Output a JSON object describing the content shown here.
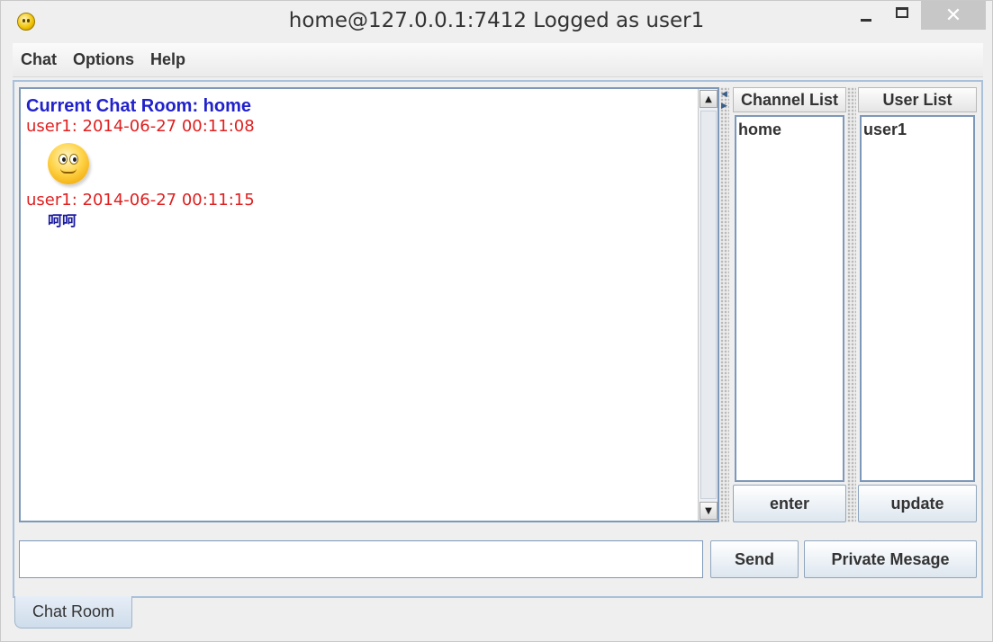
{
  "window": {
    "title": "home@127.0.0.1:7412 Logged as user1",
    "close_glyph": "✕"
  },
  "menu": [
    "Chat",
    "Options",
    "Help"
  ],
  "chat": {
    "room_title": "Current Chat Room: home",
    "messages": [
      {
        "header": "user1: 2014-06-27 00:11:08",
        "content_type": "emoticon",
        "icon": "smiley-emoticon-icon"
      },
      {
        "header": "user1: 2014-06-27 00:11:15",
        "content_type": "text",
        "text": "呵呵"
      }
    ]
  },
  "channel_list": {
    "header": "Channel List",
    "items": [
      "home"
    ],
    "button": "enter"
  },
  "user_list": {
    "header": "User List",
    "items": [
      "user1"
    ],
    "button": "update"
  },
  "composer": {
    "value": "",
    "send_label": "Send",
    "private_label": "Private Mesage"
  },
  "tabs": [
    "Chat Room"
  ],
  "colors": {
    "room_title": "#2222cc",
    "message_header": "#e02020",
    "message_text": "#1a1aa0",
    "panel_border": "#7d98b8"
  }
}
